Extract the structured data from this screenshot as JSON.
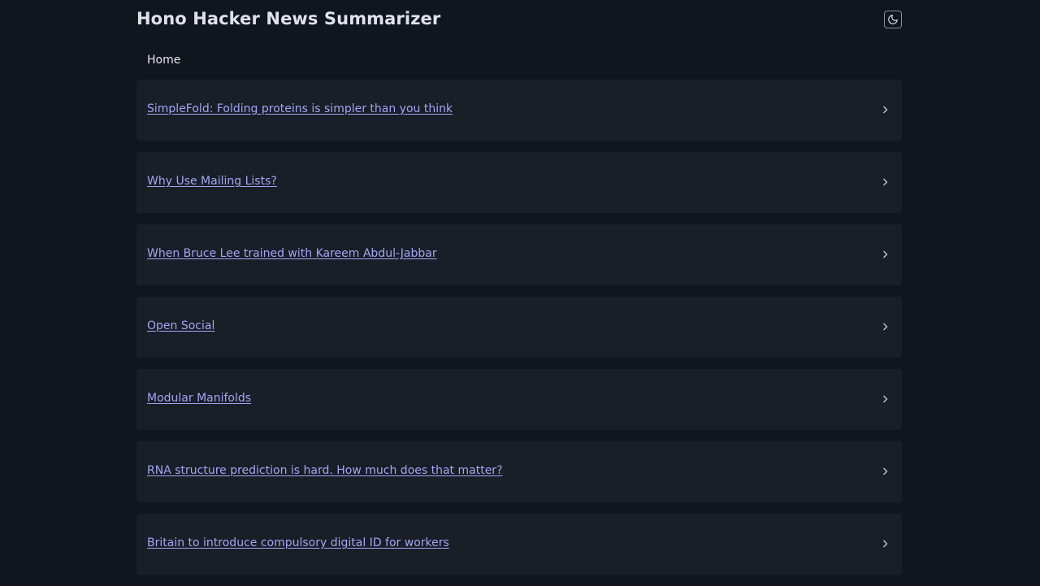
{
  "header": {
    "title": "Hono Hacker News Summarizer",
    "theme_toggle_icon": "moon-icon"
  },
  "nav": {
    "home_label": "Home"
  },
  "stories": [
    {
      "title": "SimpleFold: Folding proteins is simpler than you think"
    },
    {
      "title": "Why Use Mailing Lists?"
    },
    {
      "title": "When Bruce Lee trained with Kareem Abdul-Jabbar"
    },
    {
      "title": "Open Social"
    },
    {
      "title": "Modular Manifolds"
    },
    {
      "title": "RNA structure prediction is hard. How much does that matter?"
    },
    {
      "title": "Britain to introduce compulsory digital ID for workers"
    }
  ],
  "colors": {
    "background": "#11151d",
    "card": "#1a1e27",
    "link": "#9fa7f5"
  }
}
